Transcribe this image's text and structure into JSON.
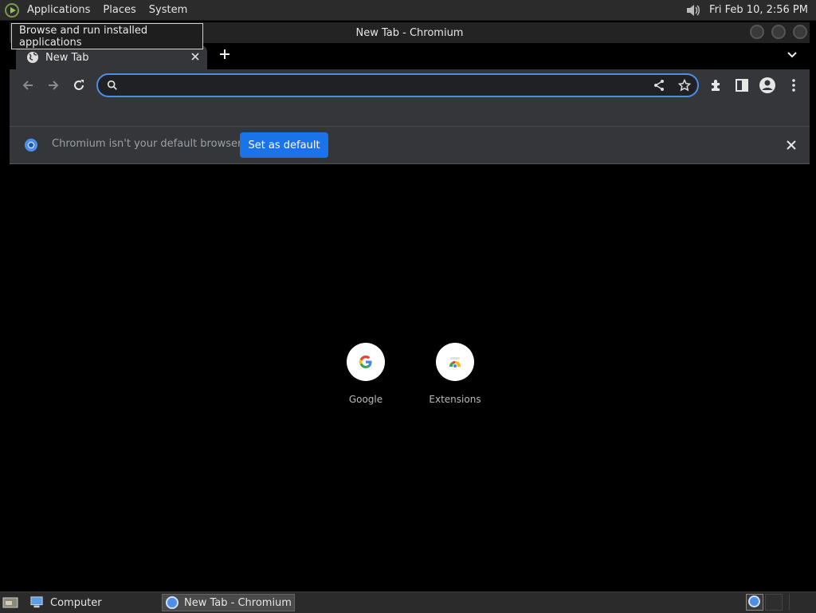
{
  "top_panel": {
    "menus": [
      "Applications",
      "Places",
      "System"
    ],
    "clock": "Fri Feb 10,  2:56 PM"
  },
  "tooltip": "Browse and run installed applications",
  "window": {
    "title": "New Tab - Chromium",
    "tab_title": "New Tab",
    "omnibox_value": "",
    "infobar_message": "Chromium isn't your default browser",
    "infobar_button": "Set as default",
    "shortcuts": [
      {
        "label": "Google",
        "icon": "google-g-icon"
      },
      {
        "label": "Extensions",
        "icon": "chrome-web-store-icon"
      }
    ]
  },
  "bottom_panel": {
    "tasks": [
      "Computer",
      "New Tab - Chromium"
    ]
  },
  "colors": {
    "accent": "#1a73e8",
    "omnibox_focus": "#4d8ee8",
    "toolbar": "#35363a"
  }
}
